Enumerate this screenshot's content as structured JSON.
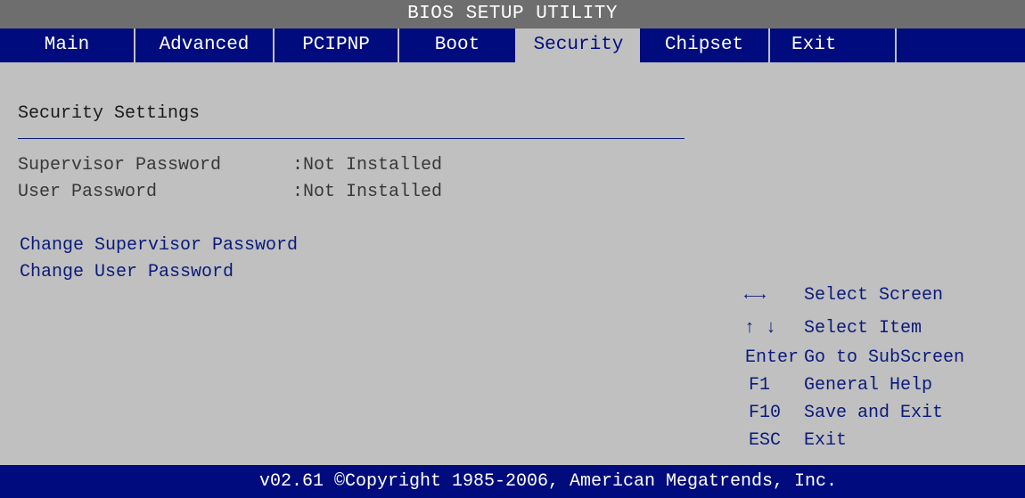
{
  "title": "BIOS SETUP UTILITY",
  "tabs": [
    {
      "label": "Main"
    },
    {
      "label": "Advanced"
    },
    {
      "label": "PCIPNP"
    },
    {
      "label": "Boot"
    },
    {
      "label": "Security"
    },
    {
      "label": "Chipset"
    },
    {
      "label": "Exit"
    }
  ],
  "active_tab": "Security",
  "main": {
    "section_title": "Security Settings",
    "rows": [
      {
        "label": "Supervisor Password",
        "value": ":Not Installed"
      },
      {
        "label": "User Password",
        "value": ":Not Installed"
      }
    ],
    "actions": [
      {
        "label": "Change Supervisor Password"
      },
      {
        "label": "Change User Password"
      }
    ]
  },
  "help": [
    {
      "key": "←→",
      "desc": "Select Screen",
      "key_icon": "left-right-arrows-icon"
    },
    {
      "key": "↑ ↓",
      "desc": "Select Item",
      "key_icon": "up-down-arrows-icon"
    },
    {
      "key": "Enter",
      "desc": "Go to SubScreen"
    },
    {
      "key": "F1",
      "desc": "General Help"
    },
    {
      "key": "F10",
      "desc": "Save and Exit"
    },
    {
      "key": "ESC",
      "desc": "Exit"
    }
  ],
  "footer": "v02.61 ©Copyright 1985-2006, American Megatrends, Inc.",
  "colors": {
    "background": "#c0c0c0",
    "menu_bar": "#000c7e",
    "title_bar": "#6e6e6e",
    "active_tab_text": "#000c7e",
    "accent_text": "#0a1a7a"
  }
}
